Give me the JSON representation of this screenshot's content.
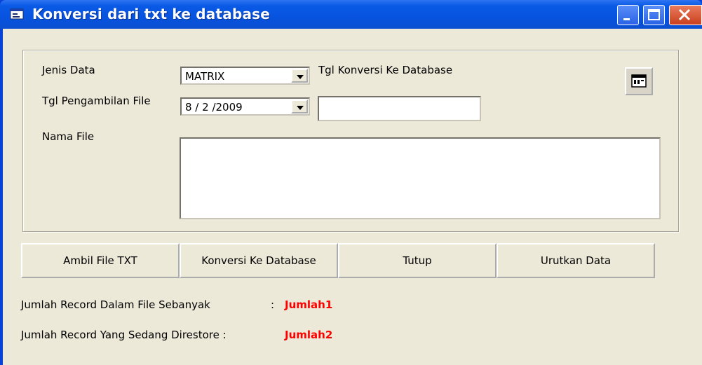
{
  "window": {
    "title": "Konversi dari txt ke database",
    "icons": {
      "app": "form-icon",
      "minimize": "minimize-icon",
      "maximize": "maximize-icon",
      "close": "close-icon"
    },
    "colors": {
      "titlebar": "#0a5ae6",
      "client": "#ece9d8",
      "status_value": "#ff0000"
    }
  },
  "form": {
    "jenis_data_label": "Jenis Data",
    "jenis_data_value": "MATRIX",
    "tgl_konversi_label": "Tgl Konversi Ke Database",
    "tgl_konversi_value": "",
    "tgl_pengambilan_label": "Tgl Pengambilan File",
    "tgl_pengambilan_value": "8 / 2 /2009",
    "nama_file_label": "Nama File",
    "nama_file_value": "",
    "calendar_icon": "calendar-icon"
  },
  "buttons": {
    "ambil": "Ambil File TXT",
    "konversi": "Konversi Ke Database",
    "tutup": "Tutup",
    "urutkan": "Urutkan Data"
  },
  "status": {
    "line1_label": "Jumlah Record Dalam File Sebanyak",
    "line1_sep": ":",
    "line1_value": "Jumlah1",
    "line2_label": "Jumlah Record Yang Sedang Direstore :",
    "line2_value": "Jumlah2"
  }
}
